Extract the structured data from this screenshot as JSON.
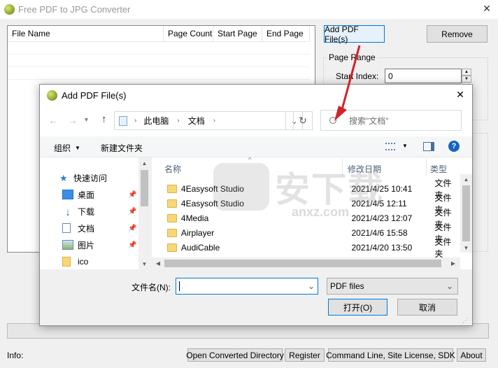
{
  "app": {
    "title": "Free PDF to JPG Converter",
    "close_glyph": "✕"
  },
  "file_table": {
    "columns": [
      "File Name",
      "Page Count",
      "Start Page",
      "End Page"
    ]
  },
  "buttons": {
    "add_pdf": "Add PDF File(s)",
    "remove": "Remove"
  },
  "page_range": {
    "group_label": "Page Range",
    "start_index_label": "Start Index:",
    "start_index_value": "0"
  },
  "status_bar": {
    "info_label": "Info:",
    "open_dir": "Open Converted Directory",
    "register": "Register",
    "command_line": "Command Line, Site License, SDK",
    "about": "About"
  },
  "dialog": {
    "title": "Add PDF File(s)",
    "close_glyph": "✕",
    "breadcrumb": [
      "此电脑",
      "文档"
    ],
    "search_placeholder": "搜索\"文档\"",
    "organize": "组织",
    "new_folder": "新建文件夹",
    "nav_pane": [
      {
        "label": "快速访问",
        "icon": "star-icon"
      },
      {
        "label": "桌面",
        "icon": "desktop-icon"
      },
      {
        "label": "下载",
        "icon": "download-icon"
      },
      {
        "label": "文档",
        "icon": "document-icon"
      },
      {
        "label": "图片",
        "icon": "picture-icon"
      },
      {
        "label": "ico",
        "icon": "folder-icon"
      }
    ],
    "columns": {
      "name": "名称",
      "date": "修改日期",
      "type": "类型"
    },
    "files": [
      {
        "name": "4Easysoft Studio",
        "date": "2021/4/25 10:41",
        "type": "文件夹"
      },
      {
        "name": "4Easysoft Studio",
        "date": "2021/4/5 12:11",
        "type": "文件夹"
      },
      {
        "name": "4Media",
        "date": "2021/4/23 12:07",
        "type": "文件夹"
      },
      {
        "name": "Airplayer",
        "date": "2021/4/6 15:58",
        "type": "文件夹"
      },
      {
        "name": "AudiCable",
        "date": "2021/4/20 13:50",
        "type": "文件夹"
      }
    ],
    "filename_label": "文件名(N):",
    "filename_value": "",
    "filter_value": "PDF files",
    "open_button": "打开(O)",
    "cancel_button": "取消"
  },
  "watermark": {
    "text": "安下载",
    "subtext": "anxz.com"
  },
  "colors": {
    "accent_blue": "#0078d7",
    "arrow_red": "#d0232a",
    "folder_yellow": "#f8d775"
  }
}
